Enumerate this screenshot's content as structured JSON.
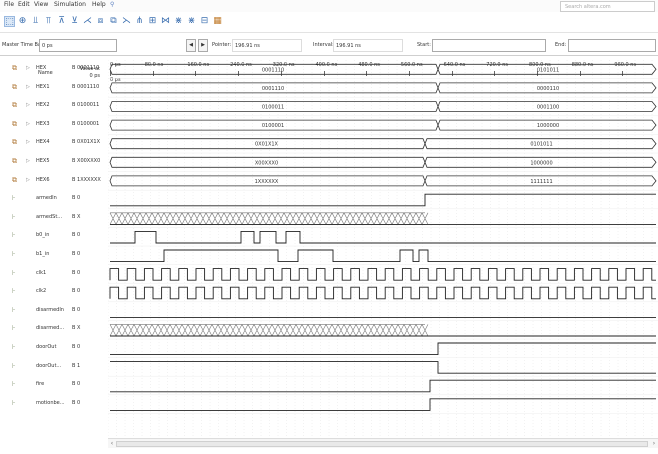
{
  "menubar": {
    "items": [
      "File",
      "Edit",
      "View",
      "Simulation",
      "Help"
    ],
    "search_placeholder": "Search altera.com"
  },
  "toolbar": {
    "icons": [
      "select-icon",
      "zoom-icon",
      "waveform-icon-1",
      "waveform-icon-2",
      "waveform-icon-3",
      "waveform-icon-4",
      "count-value-icon",
      "clock-icon",
      "invert-icon",
      "random-icon",
      "overwrite-icon",
      "grid-icon",
      "snap-icon",
      "run-functional-icon",
      "run-timing-icon",
      "generate-icon"
    ]
  },
  "timebar": {
    "master_label": "Master Time Bar:",
    "master_value": "0 ps",
    "pointer_label": "Pointer:",
    "pointer_value": "196.91 ns",
    "interval_label": "Interval:",
    "interval_value": "196.91 ns",
    "start_label": "Start:",
    "start_value": "",
    "end_label": "End:",
    "end_value": ""
  },
  "ruler": {
    "ticks": [
      "0 ps",
      "80.0 ns",
      "160.0 ns",
      "240.0 ns",
      "320.0 ns",
      "400.0 ns",
      "480.0 ns",
      "560.0 ns",
      "640.0 ns",
      "720.0 ns",
      "800.0 ns",
      "880.0 ns",
      "960.0 ns"
    ],
    "cursor_label": "0 ps"
  },
  "columns": {
    "name": "Name",
    "value_header_1": "Value at",
    "value_header_2": "0 ps"
  },
  "signals": [
    {
      "name": "HEX",
      "value": "B 0001110",
      "bus": true
    },
    {
      "name": "HEX1",
      "value": "B 0001110",
      "bus": true
    },
    {
      "name": "HEX2",
      "value": "B 0100011",
      "bus": true
    },
    {
      "name": "HEX3",
      "value": "B 0100001",
      "bus": true
    },
    {
      "name": "HEX4",
      "value": "B 0X01X1X",
      "bus": true
    },
    {
      "name": "HEX5",
      "value": "B X00XXX0",
      "bus": true
    },
    {
      "name": "HEX6",
      "value": "B 1XXXXXX",
      "bus": true
    },
    {
      "name": "armedIn",
      "value": "B 0",
      "bus": false
    },
    {
      "name": "armedSt...",
      "value": "B X",
      "bus": false
    },
    {
      "name": "b0_in",
      "value": "B 0",
      "bus": false
    },
    {
      "name": "b1_in",
      "value": "B 0",
      "bus": false
    },
    {
      "name": "clk1",
      "value": "B 0",
      "bus": false
    },
    {
      "name": "clk2",
      "value": "B 0",
      "bus": false
    },
    {
      "name": "disarmedIn",
      "value": "B 0",
      "bus": false
    },
    {
      "name": "disarmed...",
      "value": "B X",
      "bus": false
    },
    {
      "name": "doorOut",
      "value": "B 0",
      "bus": false
    },
    {
      "name": "doorOut...",
      "value": "B 1",
      "bus": false
    },
    {
      "name": "fire",
      "value": "B 0",
      "bus": false
    },
    {
      "name": "motionbe...",
      "value": "B 0",
      "bus": false
    }
  ],
  "bus_segments": [
    [
      {
        "label": "0001110"
      },
      {
        "label": "0101011"
      }
    ],
    [
      {
        "label": "0001110"
      },
      {
        "label": "0000110"
      }
    ],
    [
      {
        "label": "0100011"
      },
      {
        "label": "0001100"
      }
    ],
    [
      {
        "label": "0100001"
      },
      {
        "label": "1000000"
      }
    ],
    [
      {
        "label": "0X01X1X"
      },
      {
        "label": "0101011"
      }
    ],
    [
      {
        "label": "X00XXX0"
      },
      {
        "label": "1000000"
      }
    ],
    [
      {
        "label": "1XXXXXX"
      },
      {
        "label": "1111111"
      }
    ]
  ]
}
